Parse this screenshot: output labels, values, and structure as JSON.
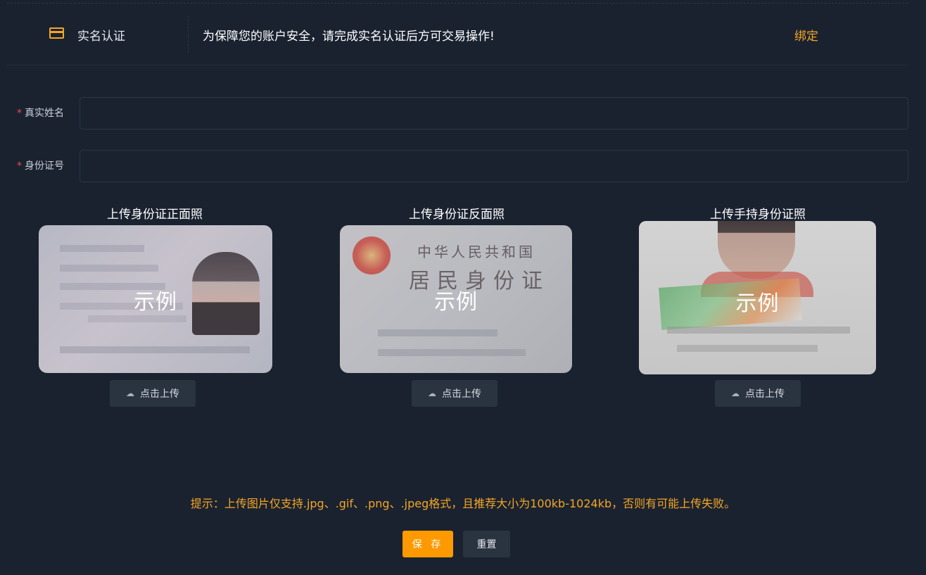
{
  "verification": {
    "title": "实名认证",
    "description": "为保障您的账户安全，请完成实名认证后方可交易操作!",
    "bind_label": "绑定"
  },
  "form": {
    "real_name": {
      "label": "真实姓名",
      "required_mark": "*",
      "value": ""
    },
    "id_number": {
      "label": "身份证号",
      "required_mark": "*",
      "value": ""
    }
  },
  "uploads": [
    {
      "title": "上传身份证正面照",
      "sample_label": "示例",
      "button_label": "点击上传"
    },
    {
      "title": "上传身份证反面照",
      "sample_label": "示例",
      "button_label": "点击上传"
    },
    {
      "title": "上传手持身份证照",
      "sample_label": "示例",
      "button_label": "点击上传"
    }
  ],
  "sample_back_text": {
    "line1": "中华人民共和国",
    "line2": "居民身份证"
  },
  "tip": "提示：上传图片仅支持.jpg、.gif、.png、.jpeg格式，且推荐大小为100kb-1024kb，否则有可能上传失败。",
  "actions": {
    "save_label": "保 存",
    "reset_label": "重置"
  },
  "colors": {
    "accent": "#f5a623",
    "primary_button": "#ff9900",
    "background": "#1a2230",
    "required": "#f04a4a"
  }
}
